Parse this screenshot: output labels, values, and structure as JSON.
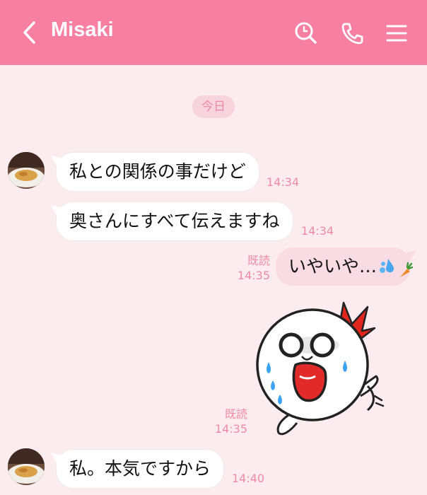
{
  "header": {
    "contact_name": "Misaki",
    "icons": [
      "back-chevron-icon",
      "search-icon",
      "phone-icon",
      "menu-icon"
    ],
    "background_color": "#f77fa2"
  },
  "date_separator": "今日",
  "messages": [
    {
      "direction": "incoming",
      "text": "私との関係の事だけど",
      "time": "14:34"
    },
    {
      "direction": "incoming",
      "text": "奥さんにすべて伝えますね",
      "time": "14:34"
    },
    {
      "direction": "outgoing",
      "text": "いやいや…",
      "emoji_icons": [
        "sweat-drops-icon",
        "carrot-icon"
      ],
      "read_label": "既読",
      "time": "14:35"
    },
    {
      "direction": "outgoing",
      "type": "sticker",
      "sticker_icon": "shocked-white-character-sticker",
      "read_label": "既読",
      "time": "14:35"
    },
    {
      "direction": "incoming",
      "text": "私。本気ですから",
      "time": "14:40"
    }
  ]
}
